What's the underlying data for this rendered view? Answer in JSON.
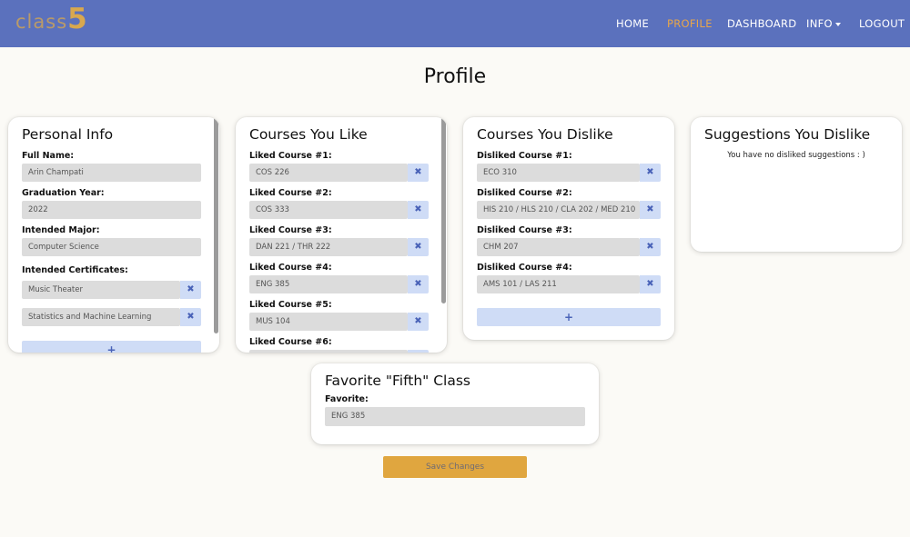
{
  "nav": {
    "logo_text": "class",
    "logo_number": "5",
    "home": "HOME",
    "profile": "PROFILE",
    "dashboard": "DASHBOARD",
    "info": "INFO",
    "logout": "LOGOUT"
  },
  "page_title": "Profile",
  "personal_info": {
    "title": "Personal Info",
    "full_name_label": "Full Name:",
    "full_name": "Arin Champati",
    "grad_year_label": "Graduation Year:",
    "grad_year": "2022",
    "major_label": "Intended Major:",
    "major": "Computer Science",
    "certificates_label": "Intended Certificates:",
    "certificates": [
      "Music Theater",
      "Statistics and Machine Learning"
    ],
    "add_icon": "+"
  },
  "liked_courses": {
    "title": "Courses You Like",
    "items": [
      {
        "label": "Liked Course #1:",
        "value": "COS 226"
      },
      {
        "label": "Liked Course #2:",
        "value": "COS 333"
      },
      {
        "label": "Liked Course #3:",
        "value": "DAN 221 / THR 222"
      },
      {
        "label": "Liked Course #4:",
        "value": "ENG 385"
      },
      {
        "label": "Liked Course #5:",
        "value": "MUS 104"
      },
      {
        "label": "Liked Course #6:",
        "value": ""
      }
    ]
  },
  "disliked_courses": {
    "title": "Courses You Dislike",
    "items": [
      {
        "label": "Disliked Course #1:",
        "value": "ECO 310"
      },
      {
        "label": "Disliked Course #2:",
        "value": "HIS 210 / HLS 210 / CLA 202 / MED 210"
      },
      {
        "label": "Disliked Course #3:",
        "value": "CHM 207"
      },
      {
        "label": "Disliked Course #4:",
        "value": "AMS 101 / LAS 211"
      }
    ],
    "add_icon": "+"
  },
  "disliked_suggestions": {
    "title": "Suggestions You Dislike",
    "empty_message": "You have no disliked suggestions : )"
  },
  "favorite_fifth": {
    "title": "Favorite \"Fifth\" Class",
    "label": "Favorite:",
    "value": "ENG 385"
  },
  "remove_icon": "✖",
  "save_button": "Save Changes",
  "colors": {
    "navbar": "#5b71bd",
    "accent": "#e0a63f",
    "button_light": "#cfdcf6"
  }
}
